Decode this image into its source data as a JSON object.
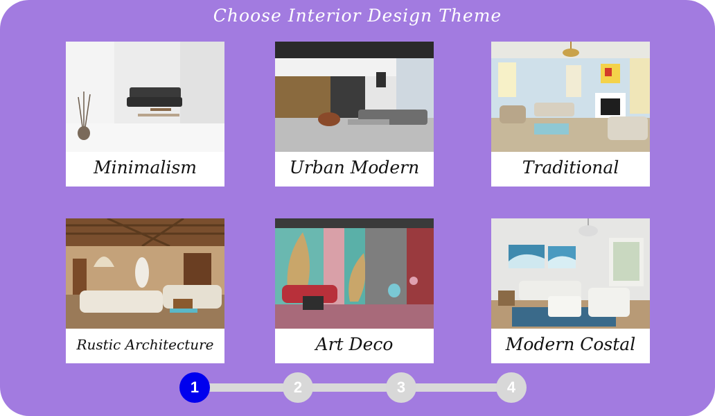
{
  "header": {
    "title": "Choose Interior Design Theme"
  },
  "themes": [
    {
      "label": "Minimalism"
    },
    {
      "label": "Urban Modern"
    },
    {
      "label": "Traditional"
    },
    {
      "label": "Rustic Architecture"
    },
    {
      "label": "Art Deco"
    },
    {
      "label": "Modern Costal"
    }
  ],
  "stepper": {
    "steps": [
      {
        "number": "1"
      },
      {
        "number": "2"
      },
      {
        "number": "3"
      },
      {
        "number": "4"
      }
    ],
    "active_step": 1
  },
  "colors": {
    "background": "#a27be0",
    "card": "#ffffff",
    "active_step": "#0000ee",
    "inactive_step": "#d8d8d8"
  }
}
